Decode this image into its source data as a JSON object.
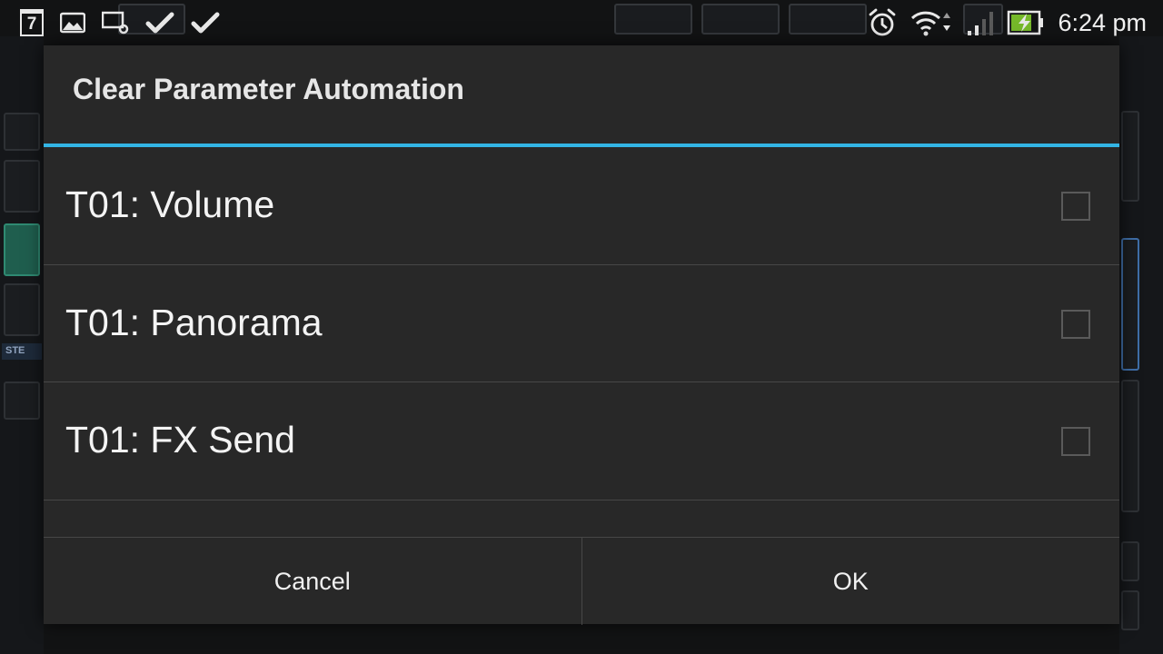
{
  "status_bar": {
    "calendar_day": "7",
    "time": "6:24 pm",
    "icons_left": [
      "calendar-icon",
      "image-icon",
      "screen-settings-icon",
      "checkmark-icon",
      "checkmark-icon"
    ],
    "icons_right": [
      "alarm-icon",
      "wifi-icon",
      "signal-icon",
      "battery-charging-icon"
    ]
  },
  "dialog": {
    "title": "Clear Parameter Automation",
    "items": [
      {
        "label": "T01: Volume",
        "checked": false
      },
      {
        "label": "T01: Panorama",
        "checked": false
      },
      {
        "label": "T01: FX Send",
        "checked": false
      }
    ],
    "buttons": {
      "cancel": "Cancel",
      "ok": "OK"
    }
  },
  "background_app": {
    "side_label": "STE"
  },
  "colors": {
    "accent": "#33b5e5",
    "dialog_bg": "#282828",
    "divider": "#474747",
    "battery_green": "#76b82a"
  }
}
